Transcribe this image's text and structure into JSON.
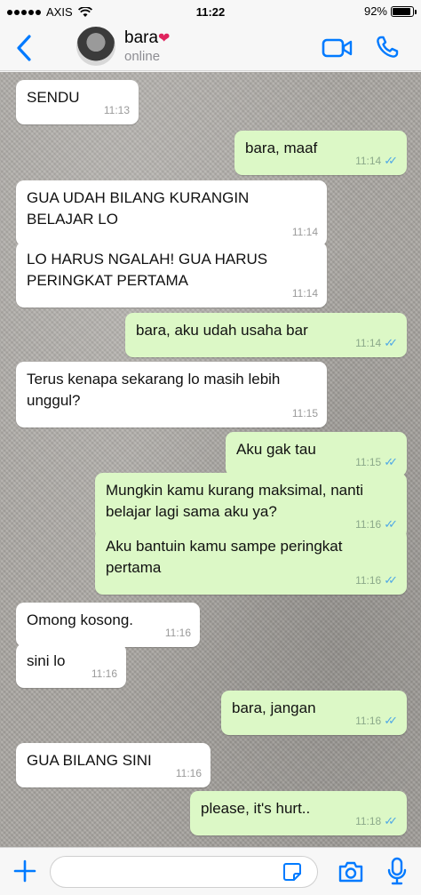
{
  "status_bar": {
    "carrier": "AXIS",
    "time": "11:22",
    "battery": "92%",
    "battery_level": 0.92
  },
  "header": {
    "contact_name": "bara",
    "name_emoji": "❤",
    "contact_status": "online"
  },
  "colors": {
    "accent": "#007aff",
    "outgoing_bubble": "#dcf8c6",
    "incoming_bubble": "#ffffff",
    "read_ticks": "#4fa8e6"
  },
  "icons": {
    "back": "chevron-left-icon",
    "video": "video-call-icon",
    "call": "phone-icon",
    "plus": "plus-icon",
    "sticker": "sticker-icon",
    "camera": "camera-icon",
    "mic": "microphone-icon"
  },
  "messages": [
    {
      "direction": "in",
      "lines": [
        "SENDU"
      ],
      "time": "11:13"
    },
    {
      "direction": "out",
      "lines": [
        "bara, maaf"
      ],
      "time": "11:14",
      "read": true
    },
    {
      "direction": "in",
      "lines": [
        "GUA UDAH BILANG KURANGIN",
        "BELAJAR LO"
      ],
      "time": "11:14"
    },
    {
      "direction": "in",
      "lines": [
        "LO HARUS NGALAH! GUA HARUS",
        "PERINGKAT PERTAMA"
      ],
      "time": "11:14"
    },
    {
      "direction": "out",
      "lines": [
        "bara, aku udah usaha bar"
      ],
      "time": "11:14",
      "read": true
    },
    {
      "direction": "in",
      "lines": [
        "Terus kenapa sekarang lo masih lebih",
        "unggul?"
      ],
      "time": "11:15"
    },
    {
      "direction": "out",
      "lines": [
        "Aku gak tau"
      ],
      "time": "11:15",
      "read": true
    },
    {
      "direction": "out",
      "lines": [
        "Mungkin kamu kurang maksimal, nanti",
        "belajar lagi sama aku ya?"
      ],
      "time": "11:16",
      "read": true
    },
    {
      "direction": "out",
      "lines": [
        "Aku bantuin kamu sampe peringkat",
        "pertama"
      ],
      "time": "11:16",
      "read": true
    },
    {
      "direction": "in",
      "lines": [
        "Omong kosong."
      ],
      "time": "11:16"
    },
    {
      "direction": "in",
      "lines": [
        "sini lo"
      ],
      "time": "11:16"
    },
    {
      "direction": "out",
      "lines": [
        "bara, jangan"
      ],
      "time": "11:16",
      "read": true
    },
    {
      "direction": "in",
      "lines": [
        "GUA BILANG SINI"
      ],
      "time": "11:16"
    },
    {
      "direction": "out",
      "lines": [
        "please, it's hurt.."
      ],
      "time": "11:18",
      "read": true
    }
  ],
  "input": {
    "placeholder": "",
    "value": ""
  }
}
